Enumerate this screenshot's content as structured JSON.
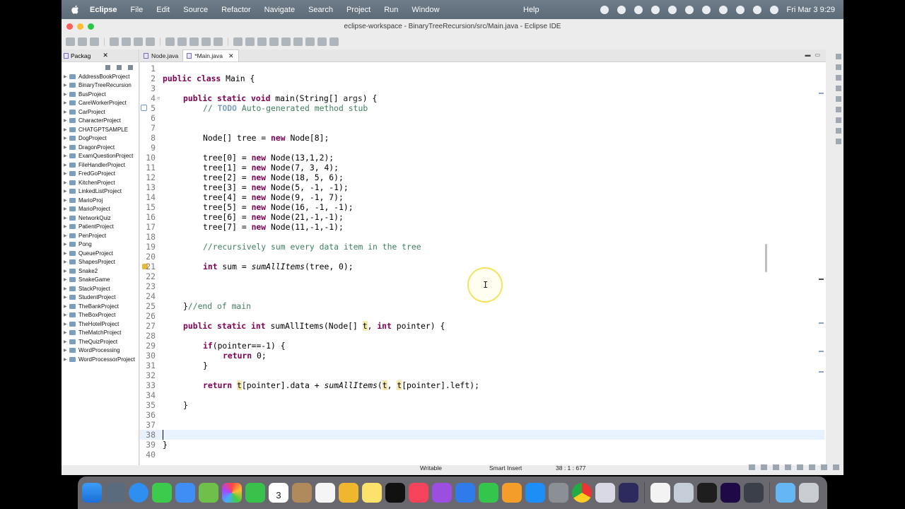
{
  "menubar": {
    "app_name": "Eclipse",
    "items": [
      "File",
      "Edit",
      "Source",
      "Refactor",
      "Navigate",
      "Search",
      "Project",
      "Run",
      "Window"
    ],
    "help": "Help",
    "clock": "Fri Mar 3  9:29"
  },
  "window": {
    "title": "eclipse-workspace - BinaryTreeRecursion/src/Main.java - Eclipse IDE"
  },
  "package_explorer": {
    "tab_label": "Packag",
    "projects": [
      "AddressBookProject",
      "BinaryTreeRecursion",
      "BusProject",
      "CareWorkerProject",
      "CarProject",
      "CharacterProject",
      "CHATGPTSAMPLE",
      "DogProject",
      "DragonProject",
      "ExamQuestionProject",
      "FileHandlerProject",
      "FredGoProject",
      "KitchenProject",
      "LinkedListProject",
      "MarioProj",
      "MarioProject",
      "NetworkQuiz",
      "PatientProject",
      "PenProject",
      "Pong",
      "QueueProject",
      "ShapesProject",
      "Snake2",
      "SnakeGame",
      "StackProject",
      "StudentProject",
      "TheBankProject",
      "TheBoxProject",
      "TheHotelProject",
      "TheMatchProject",
      "TheQuizProject",
      "WordProcessing",
      "WordProcessorProject"
    ]
  },
  "editor": {
    "tabs": [
      {
        "label": "Node.java"
      },
      {
        "label": "*Main.java"
      }
    ],
    "line_numbers": [
      "1",
      "2",
      "3",
      "4",
      "5",
      "6",
      "7",
      "8",
      "9",
      "10",
      "11",
      "12",
      "13",
      "14",
      "15",
      "16",
      "17",
      "18",
      "19",
      "20",
      "21",
      "22",
      "23",
      "24",
      "25",
      "26",
      "27",
      "28",
      "29",
      "30",
      "31",
      "32",
      "33",
      "34",
      "35",
      "36",
      "37",
      "38",
      "39",
      "40"
    ],
    "code": {
      "l2_kw": "public class",
      "l2_rest": " Main {",
      "l4_kw": "public static void",
      "l4_rest": " main(String[] ",
      "l4_args": "args",
      "l4_end": ") {",
      "l5_cm": "// ",
      "l5_todo": "TODO",
      "l5_rest": " Auto-generated method stub",
      "l8_a": "Node[] ",
      "l8_var": "tree",
      "l8_b": " = ",
      "l8_kw": "new",
      "l8_c": " Node[8];",
      "tree_lines": [
        {
          "pre": "tree[0] = ",
          "kw": "new",
          "post": " Node(13,1,2);"
        },
        {
          "pre": "tree[1] = ",
          "kw": "new",
          "post": " Node(7, 3, 4);"
        },
        {
          "pre": "tree[2] = ",
          "kw": "new",
          "post": " Node(18, 5, 6);"
        },
        {
          "pre": "tree[3] = ",
          "kw": "new",
          "post": " Node(5, -1, -1);"
        },
        {
          "pre": "tree[4] = ",
          "kw": "new",
          "post": " Node(9, -1, 7);"
        },
        {
          "pre": "tree[5] = ",
          "kw": "new",
          "post": " Node(16, -1, -1);"
        },
        {
          "pre": "tree[6] = ",
          "kw": "new",
          "post": " Node(21,-1,-1);"
        },
        {
          "pre": "tree[7] = ",
          "kw": "new",
          "post": " Node(11,-1,-1);"
        }
      ],
      "l19_cm": "//recursively sum every data item in the tree",
      "l21_kw": "int",
      "l21_var": " sum",
      "l21_b": " = ",
      "l21_call": "sumAllItems",
      "l21_c": "(tree, 0);",
      "l25_a": "}",
      "l25_cm": "//end of main",
      "l27_kw": "public static int",
      "l27_a": " sumAllItems(Node[] ",
      "l27_t": "t",
      "l27_b": ", ",
      "l27_kw2": "int",
      "l27_c": " ",
      "l27_p": "pointer",
      "l27_d": ") {",
      "l29_kw": "if",
      "l29_rest": "(pointer==-1) {",
      "l30_kw": "return",
      "l30_rest": " 0;",
      "l31": "}",
      "l33_kw": "return",
      "l33_a": " ",
      "l33_t": "t",
      "l33_b": "[pointer].data + ",
      "l33_call": "sumAllItems",
      "l33_c": "(",
      "l33_t2": "t",
      "l33_d": ", ",
      "l33_t3": "t",
      "l33_e": "[pointer].left);",
      "l35": "}",
      "l39": "}"
    }
  },
  "statusbar": {
    "mode": "Writable",
    "insert": "Smart Insert",
    "position": "38 : 1 : 677"
  },
  "dock": {
    "calendar_day": "3"
  },
  "colors": {
    "keyword": "#7f0055",
    "comment": "#3f7f5f",
    "current_line": "#e8f2fe",
    "cursor_ring": "#f2e35a"
  }
}
